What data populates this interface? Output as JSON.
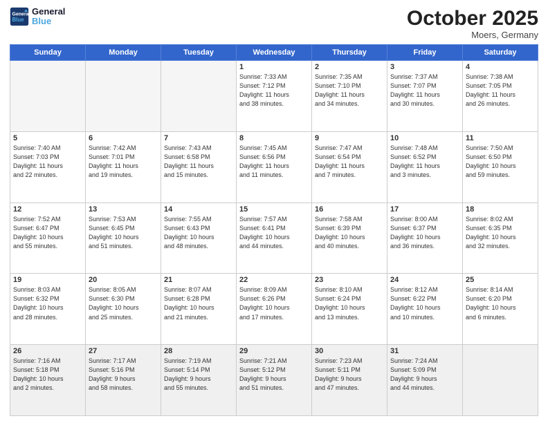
{
  "header": {
    "logo_line1": "General",
    "logo_line2": "Blue",
    "month": "October 2025",
    "location": "Moers, Germany"
  },
  "weekdays": [
    "Sunday",
    "Monday",
    "Tuesday",
    "Wednesday",
    "Thursday",
    "Friday",
    "Saturday"
  ],
  "weeks": [
    [
      {
        "day": "",
        "info": ""
      },
      {
        "day": "",
        "info": ""
      },
      {
        "day": "",
        "info": ""
      },
      {
        "day": "1",
        "info": "Sunrise: 7:33 AM\nSunset: 7:12 PM\nDaylight: 11 hours\nand 38 minutes."
      },
      {
        "day": "2",
        "info": "Sunrise: 7:35 AM\nSunset: 7:10 PM\nDaylight: 11 hours\nand 34 minutes."
      },
      {
        "day": "3",
        "info": "Sunrise: 7:37 AM\nSunset: 7:07 PM\nDaylight: 11 hours\nand 30 minutes."
      },
      {
        "day": "4",
        "info": "Sunrise: 7:38 AM\nSunset: 7:05 PM\nDaylight: 11 hours\nand 26 minutes."
      }
    ],
    [
      {
        "day": "5",
        "info": "Sunrise: 7:40 AM\nSunset: 7:03 PM\nDaylight: 11 hours\nand 22 minutes."
      },
      {
        "day": "6",
        "info": "Sunrise: 7:42 AM\nSunset: 7:01 PM\nDaylight: 11 hours\nand 19 minutes."
      },
      {
        "day": "7",
        "info": "Sunrise: 7:43 AM\nSunset: 6:58 PM\nDaylight: 11 hours\nand 15 minutes."
      },
      {
        "day": "8",
        "info": "Sunrise: 7:45 AM\nSunset: 6:56 PM\nDaylight: 11 hours\nand 11 minutes."
      },
      {
        "day": "9",
        "info": "Sunrise: 7:47 AM\nSunset: 6:54 PM\nDaylight: 11 hours\nand 7 minutes."
      },
      {
        "day": "10",
        "info": "Sunrise: 7:48 AM\nSunset: 6:52 PM\nDaylight: 11 hours\nand 3 minutes."
      },
      {
        "day": "11",
        "info": "Sunrise: 7:50 AM\nSunset: 6:50 PM\nDaylight: 10 hours\nand 59 minutes."
      }
    ],
    [
      {
        "day": "12",
        "info": "Sunrise: 7:52 AM\nSunset: 6:47 PM\nDaylight: 10 hours\nand 55 minutes."
      },
      {
        "day": "13",
        "info": "Sunrise: 7:53 AM\nSunset: 6:45 PM\nDaylight: 10 hours\nand 51 minutes."
      },
      {
        "day": "14",
        "info": "Sunrise: 7:55 AM\nSunset: 6:43 PM\nDaylight: 10 hours\nand 48 minutes."
      },
      {
        "day": "15",
        "info": "Sunrise: 7:57 AM\nSunset: 6:41 PM\nDaylight: 10 hours\nand 44 minutes."
      },
      {
        "day": "16",
        "info": "Sunrise: 7:58 AM\nSunset: 6:39 PM\nDaylight: 10 hours\nand 40 minutes."
      },
      {
        "day": "17",
        "info": "Sunrise: 8:00 AM\nSunset: 6:37 PM\nDaylight: 10 hours\nand 36 minutes."
      },
      {
        "day": "18",
        "info": "Sunrise: 8:02 AM\nSunset: 6:35 PM\nDaylight: 10 hours\nand 32 minutes."
      }
    ],
    [
      {
        "day": "19",
        "info": "Sunrise: 8:03 AM\nSunset: 6:32 PM\nDaylight: 10 hours\nand 28 minutes."
      },
      {
        "day": "20",
        "info": "Sunrise: 8:05 AM\nSunset: 6:30 PM\nDaylight: 10 hours\nand 25 minutes."
      },
      {
        "day": "21",
        "info": "Sunrise: 8:07 AM\nSunset: 6:28 PM\nDaylight: 10 hours\nand 21 minutes."
      },
      {
        "day": "22",
        "info": "Sunrise: 8:09 AM\nSunset: 6:26 PM\nDaylight: 10 hours\nand 17 minutes."
      },
      {
        "day": "23",
        "info": "Sunrise: 8:10 AM\nSunset: 6:24 PM\nDaylight: 10 hours\nand 13 minutes."
      },
      {
        "day": "24",
        "info": "Sunrise: 8:12 AM\nSunset: 6:22 PM\nDaylight: 10 hours\nand 10 minutes."
      },
      {
        "day": "25",
        "info": "Sunrise: 8:14 AM\nSunset: 6:20 PM\nDaylight: 10 hours\nand 6 minutes."
      }
    ],
    [
      {
        "day": "26",
        "info": "Sunrise: 7:16 AM\nSunset: 5:18 PM\nDaylight: 10 hours\nand 2 minutes."
      },
      {
        "day": "27",
        "info": "Sunrise: 7:17 AM\nSunset: 5:16 PM\nDaylight: 9 hours\nand 58 minutes."
      },
      {
        "day": "28",
        "info": "Sunrise: 7:19 AM\nSunset: 5:14 PM\nDaylight: 9 hours\nand 55 minutes."
      },
      {
        "day": "29",
        "info": "Sunrise: 7:21 AM\nSunset: 5:12 PM\nDaylight: 9 hours\nand 51 minutes."
      },
      {
        "day": "30",
        "info": "Sunrise: 7:23 AM\nSunset: 5:11 PM\nDaylight: 9 hours\nand 47 minutes."
      },
      {
        "day": "31",
        "info": "Sunrise: 7:24 AM\nSunset: 5:09 PM\nDaylight: 9 hours\nand 44 minutes."
      },
      {
        "day": "",
        "info": ""
      }
    ]
  ]
}
